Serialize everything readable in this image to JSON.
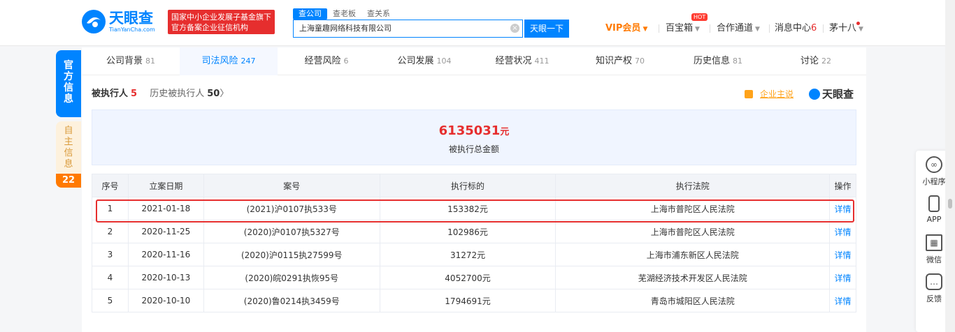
{
  "header": {
    "logo_cn": "天眼查",
    "logo_en": "TianYanCha.com",
    "slogan_line1": "国家中小企业发展子基金旗下",
    "slogan_line2": "官方备案企业征信机构",
    "search_tabs": [
      "查公司",
      "查老板",
      "查关系"
    ],
    "search_value": "上海童趣网络科技有限公司",
    "search_button": "天眼一下",
    "nav": {
      "vip": "VIP会员",
      "treasure": "百宝箱",
      "hot": "HOT",
      "cooperate": "合作通道",
      "messages": "消息中心",
      "message_count": "6",
      "user": "茅十八"
    }
  },
  "side": {
    "official": [
      "官",
      "方",
      "信",
      "息"
    ],
    "self": [
      "自",
      "主",
      "信",
      "息"
    ],
    "self_count": "22"
  },
  "tabs": [
    {
      "label": "公司背景",
      "count": "81"
    },
    {
      "label": "司法风险",
      "count": "247"
    },
    {
      "label": "经营风险",
      "count": "6"
    },
    {
      "label": "公司发展",
      "count": "104"
    },
    {
      "label": "经营状况",
      "count": "411"
    },
    {
      "label": "知识产权",
      "count": "70"
    },
    {
      "label": "历史信息",
      "count": "81"
    },
    {
      "label": "讨论",
      "count": "22"
    }
  ],
  "section": {
    "title": "被执行人",
    "count": "5",
    "history_label": "历史被执行人",
    "history_count": "50",
    "history_arrow": "〉",
    "advert": "企业主说",
    "brand": "天眼查"
  },
  "summary": {
    "amount": "6135031",
    "unit": "元",
    "label": "被执行总金额"
  },
  "table": {
    "headers": [
      "序号",
      "立案日期",
      "案号",
      "执行标的",
      "执行法院",
      "操作"
    ],
    "rows": [
      [
        "1",
        "2021-01-18",
        "(2021)沪0107执533号",
        "153382元",
        "上海市普陀区人民法院",
        "详情"
      ],
      [
        "2",
        "2020-11-25",
        "(2020)沪0107执5327号",
        "102986元",
        "上海市普陀区人民法院",
        "详情"
      ],
      [
        "3",
        "2020-11-16",
        "(2020)沪0115执27599号",
        "31272元",
        "上海市浦东新区人民法院",
        "详情"
      ],
      [
        "4",
        "2020-10-13",
        "(2020)皖0291执恢95号",
        "4052700元",
        "芜湖经济技术开发区人民法院",
        "详情"
      ],
      [
        "5",
        "2020-10-10",
        "(2020)鲁0214执3459号",
        "1794691元",
        "青岛市城阳区人民法院",
        "详情"
      ]
    ]
  },
  "floatbar": [
    {
      "label": "小程序",
      "icon": "mini-program-icon"
    },
    {
      "label": "APP",
      "icon": "phone-icon"
    },
    {
      "label": "微信",
      "icon": "qrcode-icon"
    },
    {
      "label": "反馈",
      "icon": "feedback-icon"
    }
  ],
  "colors": {
    "brand": "#0084ff",
    "alert": "#e62e2e",
    "vip": "#ff7a00"
  }
}
